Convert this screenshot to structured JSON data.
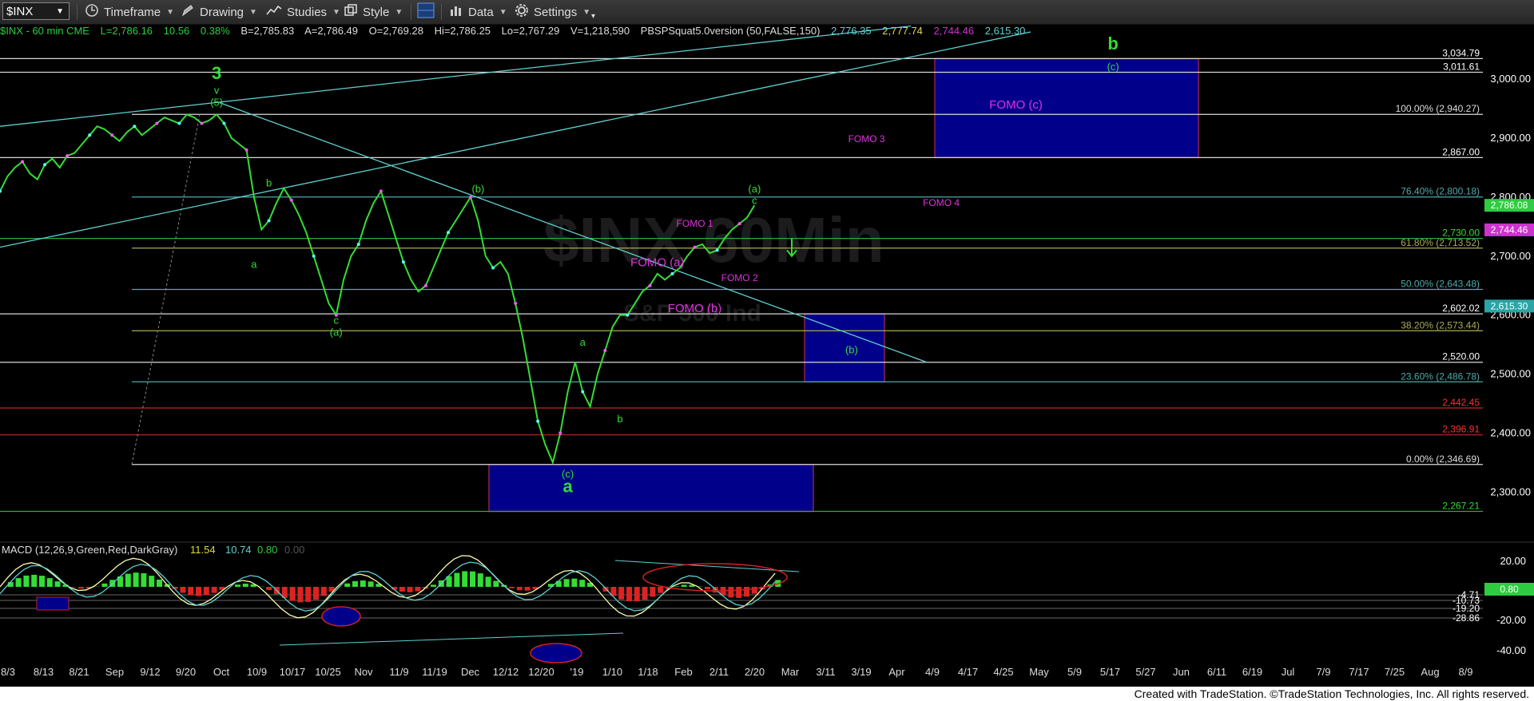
{
  "toolbar": {
    "symbol": "$INX",
    "timeframe": "Timeframe",
    "drawing": "Drawing",
    "studies": "Studies",
    "style": "Style",
    "data": "Data",
    "settings": "Settings"
  },
  "info_line": {
    "symbol_desc": "$INX - 60 min  CME",
    "last": "L=2,786.16",
    "change": "10.56",
    "change_pct": "0.38%",
    "bid": "B=2,785.83",
    "ask": "A=2,786.49",
    "open": "O=2,769.28",
    "high": "Hi=2,786.25",
    "low": "Lo=2,767.29",
    "volume": "V=1,218,590",
    "indicator": "PBSPSquat5.0version (50,FALSE,150)",
    "ind_v1": "2,776.35",
    "ind_v2": "2,777.74",
    "ind_v3": "2,744.46",
    "ind_v4": "2,615.30"
  },
  "watermark": "$INX 60Min",
  "watermark_sub": "S&P 500 Ind",
  "footer": "Created with TradeStation. ©TradeStation Technologies, Inc. All rights reserved.",
  "macd_label": {
    "text": "MACD (12,26,9,Green,Red,DarkGray)",
    "v1": "11.54",
    "v2": "10.74",
    "v3": "0.80",
    "v4": "0.00"
  },
  "colors": {
    "bg": "#000000",
    "price_axis": "#ffffff",
    "green": "#2ecc40",
    "magenta": "#cc33cc",
    "cyan": "#5fd0d0",
    "box_blue": "#00008b",
    "red_level": "#ff2020",
    "fib_teal": "#4faaaa",
    "fib_olive": "#aaaa55"
  },
  "chart_data": {
    "type": "line",
    "title": "$INX - 60 min",
    "ylim": [
      2230,
      3080
    ],
    "price_ticks": [
      "3,000.00",
      "2,900.00",
      "2,800.00",
      "2,700.00",
      "2,600.00",
      "2,500.00",
      "2,400.00",
      "2,300.00"
    ],
    "date_ticks": [
      "8/3",
      "8/13",
      "8/21",
      "Sep",
      "9/12",
      "9/20",
      "Oct",
      "10/9",
      "10/17",
      "10/25",
      "Nov",
      "11/9",
      "11/19",
      "Dec",
      "12/12",
      "12/20",
      "'19",
      "1/10",
      "1/18",
      "Feb",
      "2/11",
      "2/20",
      "Mar",
      "3/11",
      "3/19",
      "Apr",
      "4/9",
      "4/17",
      "4/25",
      "May",
      "5/9",
      "5/17",
      "5/27",
      "Jun",
      "6/11",
      "6/19",
      "Jul",
      "7/9",
      "7/17",
      "7/25",
      "Aug",
      "8/9"
    ],
    "series": [
      {
        "name": "$INX",
        "points": [
          [
            0,
            2810
          ],
          [
            1,
            2835
          ],
          [
            2,
            2850
          ],
          [
            3,
            2860
          ],
          [
            4,
            2840
          ],
          [
            5,
            2830
          ],
          [
            6,
            2855
          ],
          [
            7,
            2865
          ],
          [
            8,
            2850
          ],
          [
            9,
            2870
          ],
          [
            10,
            2875
          ],
          [
            11,
            2890
          ],
          [
            12,
            2905
          ],
          [
            13,
            2920
          ],
          [
            14,
            2915
          ],
          [
            15,
            2905
          ],
          [
            16,
            2895
          ],
          [
            17,
            2910
          ],
          [
            18,
            2920
          ],
          [
            19,
            2905
          ],
          [
            20,
            2915
          ],
          [
            21,
            2925
          ],
          [
            22,
            2935
          ],
          [
            23,
            2930
          ],
          [
            24,
            2925
          ],
          [
            25,
            2940
          ],
          [
            26,
            2935
          ],
          [
            27,
            2925
          ],
          [
            28,
            2930
          ],
          [
            29,
            2940
          ],
          [
            30,
            2925
          ],
          [
            31,
            2900
          ],
          [
            32,
            2890
          ],
          [
            33,
            2880
          ],
          [
            34,
            2800
          ],
          [
            35,
            2745
          ],
          [
            36,
            2760
          ],
          [
            37,
            2790
          ],
          [
            38,
            2815
          ],
          [
            39,
            2795
          ],
          [
            40,
            2770
          ],
          [
            41,
            2740
          ],
          [
            42,
            2700
          ],
          [
            43,
            2660
          ],
          [
            44,
            2620
          ],
          [
            45,
            2600
          ],
          [
            46,
            2660
          ],
          [
            47,
            2700
          ],
          [
            48,
            2720
          ],
          [
            49,
            2760
          ],
          [
            50,
            2790
          ],
          [
            51,
            2810
          ],
          [
            52,
            2770
          ],
          [
            53,
            2730
          ],
          [
            54,
            2690
          ],
          [
            55,
            2660
          ],
          [
            56,
            2640
          ],
          [
            57,
            2650
          ],
          [
            58,
            2680
          ],
          [
            59,
            2710
          ],
          [
            60,
            2740
          ],
          [
            61,
            2760
          ],
          [
            62,
            2780
          ],
          [
            63,
            2800
          ],
          [
            64,
            2760
          ],
          [
            65,
            2700
          ],
          [
            66,
            2680
          ],
          [
            67,
            2690
          ],
          [
            68,
            2670
          ],
          [
            69,
            2620
          ],
          [
            70,
            2560
          ],
          [
            71,
            2490
          ],
          [
            72,
            2420
          ],
          [
            73,
            2380
          ],
          [
            74,
            2350
          ],
          [
            75,
            2400
          ],
          [
            76,
            2470
          ],
          [
            77,
            2520
          ],
          [
            78,
            2470
          ],
          [
            79,
            2445
          ],
          [
            80,
            2500
          ],
          [
            81,
            2540
          ],
          [
            82,
            2580
          ],
          [
            83,
            2600
          ],
          [
            84,
            2600
          ],
          [
            85,
            2620
          ],
          [
            86,
            2640
          ],
          [
            87,
            2650
          ],
          [
            88,
            2670
          ],
          [
            89,
            2660
          ],
          [
            90,
            2670
          ],
          [
            91,
            2680
          ],
          [
            92,
            2700
          ],
          [
            93,
            2715
          ],
          [
            94,
            2720
          ],
          [
            95,
            2705
          ],
          [
            96,
            2710
          ],
          [
            97,
            2730
          ],
          [
            98,
            2745
          ],
          [
            99,
            2755
          ],
          [
            100,
            2765
          ],
          [
            101,
            2786
          ]
        ]
      }
    ],
    "levels": [
      {
        "label": "3,034.79",
        "value": 3034.79
      },
      {
        "label": "3,011.61",
        "value": 3011.61
      },
      {
        "label": "100.00% (2,940.27)",
        "value": 2940.27
      },
      {
        "label": "2,867.00",
        "value": 2867.0
      },
      {
        "label": "76.40% (2,800.18)",
        "value": 2800.18
      },
      {
        "label": "2,730.00",
        "value": 2730.0
      },
      {
        "label": "61.80% (2,713.52)",
        "value": 2713.52
      },
      {
        "label": "50.00% (2,643.48)",
        "value": 2643.48
      },
      {
        "label": "2,602.02",
        "value": 2602.02
      },
      {
        "label": "38.20% (2,573.44)",
        "value": 2573.44
      },
      {
        "label": "2,520.00",
        "value": 2520.0
      },
      {
        "label": "23.60% (2,486.78)",
        "value": 2486.78
      },
      {
        "label": "2,442.45",
        "value": 2442.45
      },
      {
        "label": "2,396.91",
        "value": 2396.91
      },
      {
        "label": "0.00% (2,346.69)",
        "value": 2346.69
      },
      {
        "label": "2,267.21",
        "value": 2267.21
      }
    ],
    "last_price_badges": [
      {
        "label": "2,786.08",
        "value": 2786.08
      },
      {
        "label": "2,744.46",
        "value": 2744.46
      },
      {
        "label": "2,615.30",
        "value": 2615.3
      }
    ],
    "annotations": [
      {
        "text": "3",
        "x": 29,
        "y": 3000
      },
      {
        "text": "v",
        "x": 29,
        "y": 2975
      },
      {
        "text": "(5)",
        "x": 29,
        "y": 2955
      },
      {
        "text": "b",
        "x": 36,
        "y": 2818
      },
      {
        "text": "a",
        "x": 34,
        "y": 2680
      },
      {
        "text": "c",
        "x": 45,
        "y": 2585
      },
      {
        "text": "(a)",
        "x": 45,
        "y": 2565
      },
      {
        "text": "(b)",
        "x": 64,
        "y": 2808
      },
      {
        "text": "a",
        "x": 78,
        "y": 2548
      },
      {
        "text": "b",
        "x": 83,
        "y": 2418
      },
      {
        "text": "(c)",
        "x": 76,
        "y": 2325
      },
      {
        "text": "a",
        "x": 76,
        "y": 2300
      },
      {
        "text": "(a)",
        "x": 101,
        "y": 2808
      },
      {
        "text": "c",
        "x": 101,
        "y": 2788
      },
      {
        "text": "(b)",
        "x": 114,
        "y": 2535
      },
      {
        "text": "b",
        "x": 149,
        "y": 3050
      },
      {
        "text": "(c)",
        "x": 149,
        "y": 3015
      },
      {
        "text": "FOMO (c)",
        "x": 136,
        "y": 2950
      },
      {
        "text": "FOMO 3",
        "x": 116,
        "y": 2893
      },
      {
        "text": "FOMO 4",
        "x": 126,
        "y": 2785
      },
      {
        "text": "FOMO 1",
        "x": 93,
        "y": 2750
      },
      {
        "text": "FOMO (a)",
        "x": 88,
        "y": 2683
      },
      {
        "text": "FOMO 2",
        "x": 99,
        "y": 2658
      },
      {
        "text": "FOMO (b)",
        "x": 93,
        "y": 2605
      }
    ],
    "macd_ticks": [
      "20.00",
      "-20.00",
      "-40.00"
    ],
    "macd_levels": [
      "-4.71",
      "-10.73",
      "-19.20",
      "-28.86"
    ],
    "macd_badge": "0.80"
  }
}
